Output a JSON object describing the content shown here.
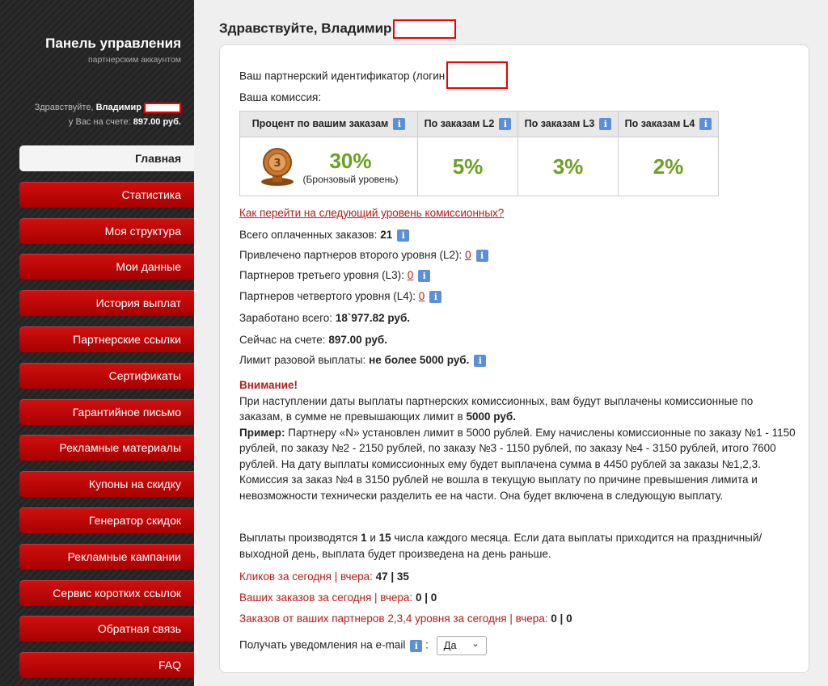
{
  "sidebar": {
    "title": "Панель управления",
    "subtitle": "партнерским аккаунтом",
    "greeting_prefix": "Здравствуйте,",
    "user_name": "Владимир",
    "balance_prefix": "у Вас на счете:",
    "balance": "897.00 руб.",
    "menu": [
      "Главная",
      "Статистика",
      "Моя структура",
      "Мои данные",
      "История выплат",
      "Партнерские ссылки",
      "Сертификаты",
      "Гарантийное письмо",
      "Рекламные материалы",
      "Купоны на скидку",
      "Генератор скидок",
      "Рекламные кампании",
      "Сервис коротких ссылок",
      "Обратная связь",
      "FAQ"
    ]
  },
  "main": {
    "greeting": "Здравствуйте, Владимир",
    "partner_id_label": "Ваш партнерский идентификатор (логин",
    "commission_label": "Ваша комиссия:",
    "table": {
      "headers": [
        "Процент по вашим заказам",
        "По заказам L2",
        "По заказам L3",
        "По заказам L4"
      ],
      "own_pct": "30%",
      "own_level": "(Бронзовый уровень)",
      "l2": "5%",
      "l3": "3%",
      "l4": "2%"
    },
    "next_level_link": "Как перейти на следующий уровень комиссионных?",
    "stats": {
      "orders_label": "Всего оплаченных заказов:",
      "orders_value": "21",
      "l2_label": "Привлечено партнеров второго уровня (L2):",
      "l2_value": "0",
      "l3_label": "Партнеров третьего уровня (L3):",
      "l3_value": "0",
      "l4_label": "Партнеров четвертого уровня (L4):",
      "l4_value": "0",
      "earned_label": "Заработано всего:",
      "earned_value": "18`977.82 руб.",
      "balance_label": "Сейчас на счете:",
      "balance_value": "897.00 руб.",
      "limit_label": "Лимит разовой выплаты:",
      "limit_value": "не более 5000 руб."
    },
    "notice": {
      "title": "Внимание!",
      "text1": "При наступлении даты выплаты партнерских комиссионных, вам будут выплачены комиссионные по заказам, в сумме не превышающих лимит в",
      "text1_bold": "5000 руб.",
      "example_label": "Пример:",
      "example_text": "Партнеру «N» установлен лимит в 5000 рублей. Ему начислены комиссионные по заказу №1 - 1150 рублей, по заказу №2 - 2150 рублей, по заказу №3 - 1150 рублей, по заказу №4 - 3150 рублей, итого 7600 рублей. На дату выплаты комиссионных ему будет выплачена сумма в 4450 рублей за заказы №1,2,3. Комиссия за заказ №4 в 3150 рублей не вошла в текущую выплату по причине превышения лимита и невозможности технически разделить ее на части. Она будет включена в следующую выплату."
    },
    "payout": {
      "p1": "Выплаты производятся",
      "d1": "1",
      "and": "и",
      "d2": "15",
      "p2": "числа каждого месяца. Если дата выплаты приходится на праздничный/выходной день, выплата будет произведена на день раньше."
    },
    "clicks_label": "Кликов за сегодня | вчера:",
    "clicks_value": "47 | 35",
    "my_orders_label": "Ваших заказов за сегодня | вчера:",
    "my_orders_value": "0 | 0",
    "partner_orders_label": "Заказов от ваших партнеров 2,3,4 уровня за сегодня | вчера:",
    "partner_orders_value": "0 | 0",
    "notify_label": "Получать уведомления на e-mail",
    "notify_value": "Да"
  }
}
